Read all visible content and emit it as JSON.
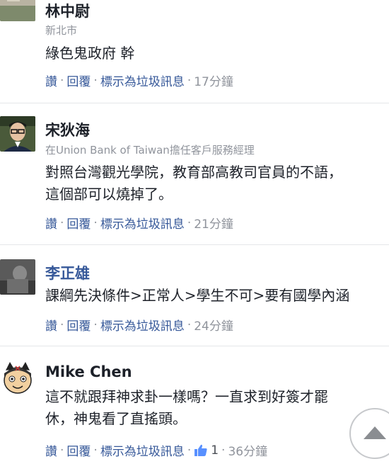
{
  "comments": [
    {
      "name": "林中尉",
      "subtitle": "新北市",
      "lines": [
        "綠色鬼政府 幹"
      ],
      "actions": {
        "like": "讚",
        "reply": "回覆",
        "spam": "標示為垃圾訊息",
        "time": "17分鐘"
      }
    },
    {
      "name": "宋狄海",
      "subtitle": "在Union Bank of Taiwan擔任客戶服務經理",
      "lines": [
        "對照台灣觀光學院，教育部高教司官員的不語，",
        "這個部可以燒掉了。"
      ],
      "actions": {
        "like": "讚",
        "reply": "回覆",
        "spam": "標示為垃圾訊息",
        "time": "21分鐘"
      }
    },
    {
      "name": "李正雄",
      "lines": [
        "課綱先決條件>正常人>學生不可>要有國學內涵"
      ],
      "actions": {
        "like": "讚",
        "reply": "回覆",
        "spam": "標示為垃圾訊息",
        "time": "24分鐘"
      }
    },
    {
      "name": "Mike Chen",
      "lines": [
        "這不就跟拜神求卦一樣嗎？一直求到好簽才罷",
        "休，神鬼看了直搖頭。"
      ],
      "actions": {
        "like": "讚",
        "reply": "回覆",
        "spam": "標示為垃圾訊息",
        "like_count": "1",
        "time": "36分鐘"
      }
    }
  ],
  "icons": {
    "like": "thumbs-up-icon",
    "scroll_top": "arrow-up-icon"
  },
  "colors": {
    "link": "#365899",
    "meta": "#90949c",
    "divider": "#e5e6e9"
  }
}
